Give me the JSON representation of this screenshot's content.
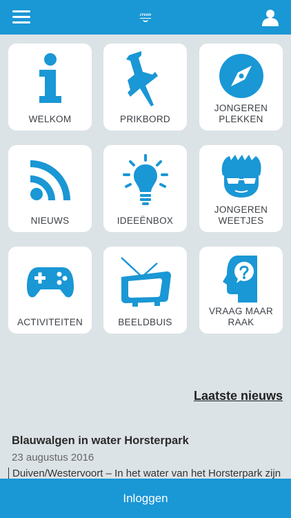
{
  "header": {
    "logo_text": "creon"
  },
  "tiles": [
    {
      "label": "WELKOM",
      "icon": "info-icon"
    },
    {
      "label": "PRIKBORD",
      "icon": "pushpin-icon"
    },
    {
      "label": "JONGEREN\nPLEKKEN",
      "icon": "compass-icon"
    },
    {
      "label": "NIEUWS",
      "icon": "rss-icon"
    },
    {
      "label": "IDEEËNBOX",
      "icon": "lightbulb-icon"
    },
    {
      "label": "JONGEREN\nWEETJES",
      "icon": "cool-face-icon"
    },
    {
      "label": "ACTIVITEITEN",
      "icon": "gamepad-icon"
    },
    {
      "label": "BEELDBUIS",
      "icon": "tv-icon"
    },
    {
      "label": "VRAAG MAAR\nRAAK",
      "icon": "question-head-icon"
    }
  ],
  "news": {
    "heading": "Laatste nieuws",
    "title": "Blauwalgen in water Horsterpark",
    "date": "23 augustus 2016",
    "excerpt": "Duiven/Westervoort – In het water van het Horsterpark zijn"
  },
  "footer": {
    "login_label": "Inloggen"
  },
  "colors": {
    "brand": "#1a97d5",
    "background": "#dce3e7"
  }
}
